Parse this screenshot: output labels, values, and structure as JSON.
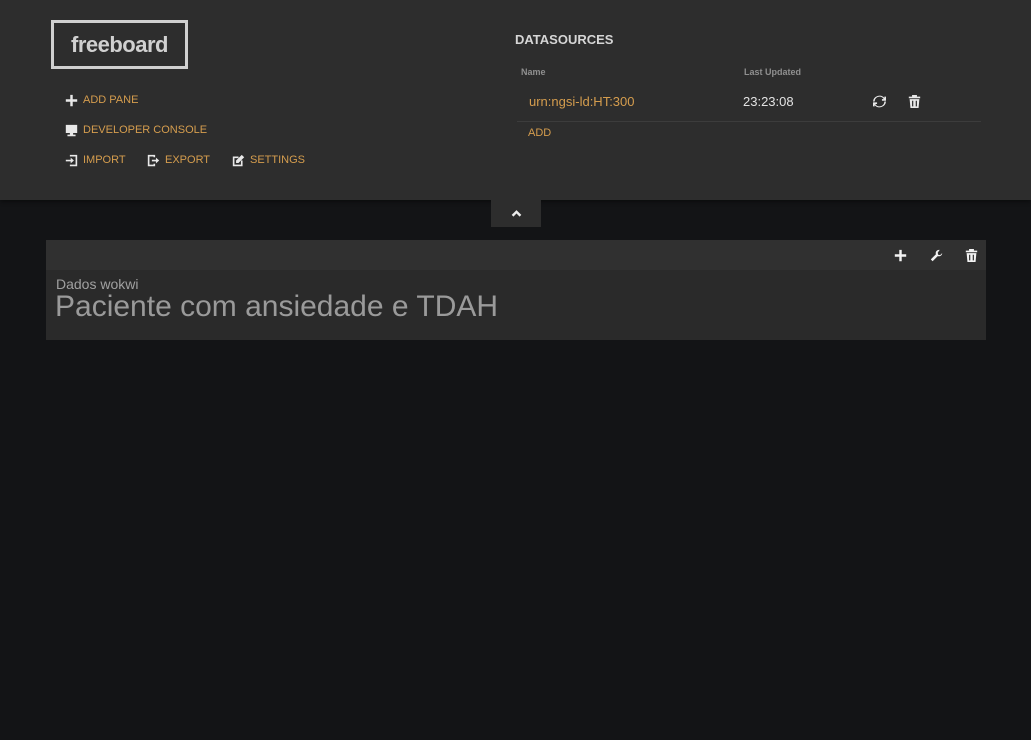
{
  "header": {
    "logo": "freeboard",
    "menu": {
      "add_pane": "ADD PANE",
      "developer_console": "DEVELOPER CONSOLE",
      "import": "IMPORT",
      "export": "EXPORT",
      "settings": "SETTINGS"
    }
  },
  "datasources": {
    "title": "DATASOURCES",
    "columns": {
      "name": "Name",
      "last_updated": "Last Updated"
    },
    "rows": [
      {
        "name": "urn:ngsi-ld:HT:300",
        "last_updated": "23:23:08"
      }
    ],
    "add_label": "ADD"
  },
  "pane": {
    "widget_title": "Dados wokwi",
    "widget_value": "Paciente com ansiedade e TDAH"
  },
  "icons": {
    "add_pane": "plus-icon",
    "developer_console": "monitor-icon",
    "import": "import-icon",
    "export": "export-icon",
    "settings": "edit-icon",
    "refresh": "refresh-icon",
    "delete": "trash-icon",
    "toggle": "chevron-up-icon",
    "pane_add": "plus-icon",
    "pane_settings": "wrench-icon",
    "pane_delete": "trash-icon"
  },
  "colors": {
    "accent": "#d59d4e",
    "header_bg": "#2d2d2d",
    "page_bg": "#131416",
    "pane_bg": "#2a2a2a"
  }
}
